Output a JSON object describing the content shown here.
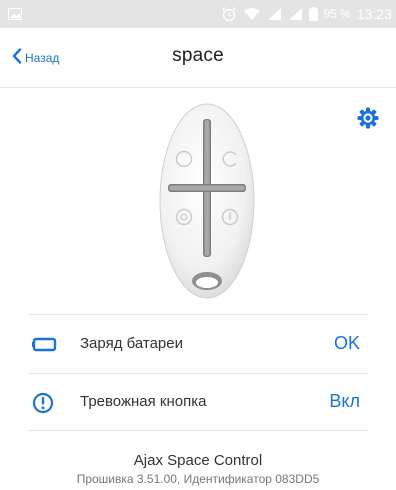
{
  "status_bar": {
    "battery_percent": "95 %",
    "time": "13:23",
    "icons": [
      "image-icon",
      "alarm-clock-icon",
      "wifi-icon",
      "signal-icon",
      "signal-icon",
      "battery-icon"
    ]
  },
  "nav": {
    "back_label": "Назад",
    "title": "space"
  },
  "rows": [
    {
      "icon": "battery-outline-icon",
      "label": "Заряд батареи",
      "value": "OK"
    },
    {
      "icon": "alert-circle-icon",
      "label": "Тревожная кнопка",
      "value": "Вкл"
    }
  ],
  "footer": {
    "device_name": "Ajax Space Control",
    "device_info": "Прошивка 3.51.00, Идентификатор 083DD5"
  },
  "colors": {
    "accent": "#1a73d9",
    "status_bar": "#e4e4e4"
  }
}
